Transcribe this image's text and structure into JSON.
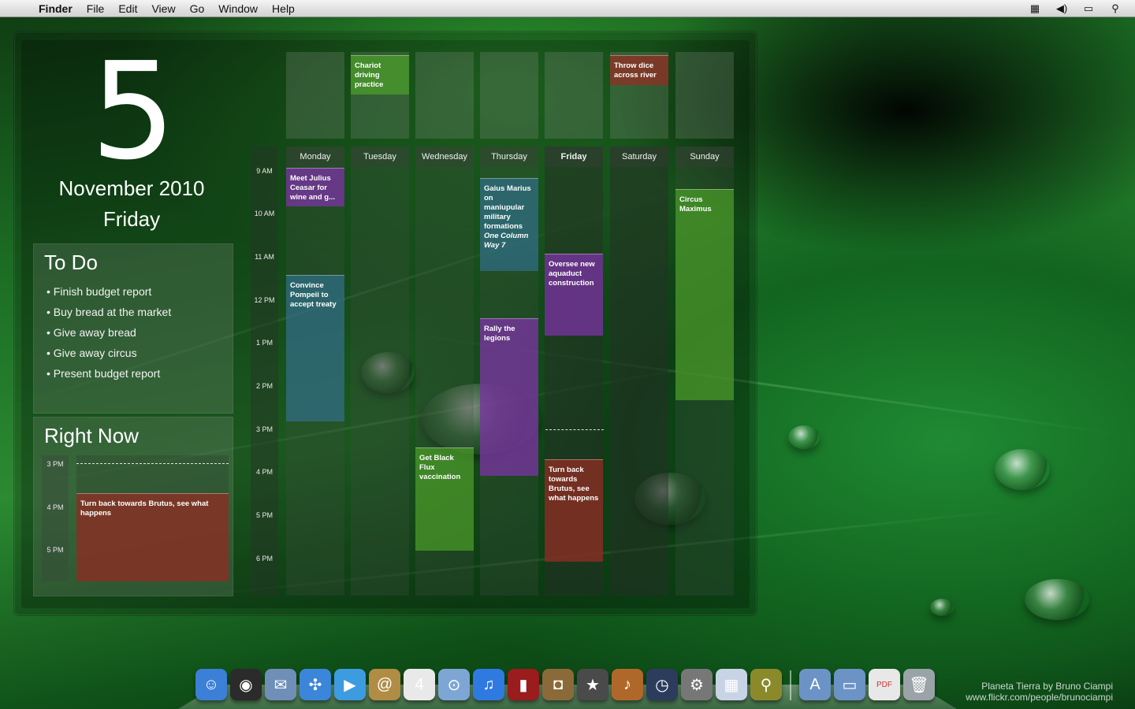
{
  "menubar": {
    "app": "Finder",
    "items": [
      "File",
      "Edit",
      "View",
      "Go",
      "Window",
      "Help"
    ],
    "status_icons": [
      "spaces-icon",
      "volume-icon",
      "battery-icon",
      "spotlight-icon"
    ]
  },
  "date": {
    "day_number": "5",
    "month_year": "November 2010",
    "weekday": "Friday"
  },
  "todo": {
    "title": "To Do",
    "items": [
      "• Finish budget report",
      "• Buy bread at the market",
      "• Give away bread",
      "• Give away circus",
      "• Present budget report"
    ]
  },
  "right_now": {
    "title": "Right Now",
    "hours": [
      "3 PM",
      "4 PM",
      "5 PM"
    ],
    "event": "Turn back towards Brutus, see what happens"
  },
  "calendar": {
    "days": [
      "Monday",
      "Tuesday",
      "Wednesday",
      "Thursday",
      "Friday",
      "Saturday",
      "Sunday"
    ],
    "today": "Friday",
    "hours": [
      "9 AM",
      "10 AM",
      "11 AM",
      "12 PM",
      "1 PM",
      "2 PM",
      "3 PM",
      "4 PM",
      "5 PM",
      "6 PM"
    ],
    "all_day_events": {
      "tuesday": "Chariot driving practice",
      "saturday": "Throw dice across river"
    },
    "events": {
      "mon_julius": "Meet Julius Ceasar for wine and g...",
      "mon_pompeii": "Convince Pompeii to accept treaty",
      "wed_flux": "Get Black Flux vaccination",
      "thu_gaius": "Gaius Marius on maniupular military formations",
      "thu_gaius_loc": "One Column Way 7",
      "thu_rally": "Rally the legions",
      "fri_aqueduct": "Oversee new aquaduct construction",
      "fri_brutus": "Turn back towards Brutus, see what happens",
      "sun_circus": "Circus Maximus"
    }
  },
  "dock": {
    "apps": [
      {
        "name": "finder-icon",
        "glyph": "☺",
        "color": "#3c7fd6"
      },
      {
        "name": "dashboard-icon",
        "glyph": "◉",
        "color": "#2b2b2b"
      },
      {
        "name": "mail-icon",
        "glyph": "✉",
        "color": "#6f8fb8"
      },
      {
        "name": "safari-icon",
        "glyph": "✣",
        "color": "#3b86d8"
      },
      {
        "name": "ichat-icon",
        "glyph": "▶",
        "color": "#3d9be0"
      },
      {
        "name": "address-book-icon",
        "glyph": "@",
        "color": "#b08c45"
      },
      {
        "name": "ical-icon",
        "glyph": "4",
        "color": "#e9e9e9"
      },
      {
        "name": "preview-icon",
        "glyph": "⊙",
        "color": "#7da6d4"
      },
      {
        "name": "itunes-icon",
        "glyph": "♫",
        "color": "#2f7ae0"
      },
      {
        "name": "front-row-icon",
        "glyph": "▮",
        "color": "#9a1c1c"
      },
      {
        "name": "iphoto-icon",
        "glyph": "◘",
        "color": "#8b6a3a"
      },
      {
        "name": "imovie-icon",
        "glyph": "★",
        "color": "#4a4a4a"
      },
      {
        "name": "garageband-icon",
        "glyph": "♪",
        "color": "#b0682a"
      },
      {
        "name": "time-machine-icon",
        "glyph": "◷",
        "color": "#2c3c5c"
      },
      {
        "name": "system-preferences-icon",
        "glyph": "⚙",
        "color": "#777777"
      },
      {
        "name": "calendar-widget-icon",
        "glyph": "▦",
        "color": "#c9d3e6"
      },
      {
        "name": "microscope-icon",
        "glyph": "⚲",
        "color": "#8a8a2a"
      }
    ],
    "folders": [
      {
        "name": "applications-folder-icon",
        "glyph": "A",
        "color": "#6c93c6"
      },
      {
        "name": "documents-folder-icon",
        "glyph": "▭",
        "color": "#6c93c6"
      },
      {
        "name": "pdf-document-icon",
        "glyph": "PDF",
        "color": "#e8e8e8"
      },
      {
        "name": "trash-icon",
        "glyph": "🗑",
        "color": "#9aa3a8"
      }
    ]
  },
  "credit": {
    "line1": "Planeta Tierra by Bruno Ciampi",
    "line2": "www.flickr.com/people/brunociampi"
  }
}
